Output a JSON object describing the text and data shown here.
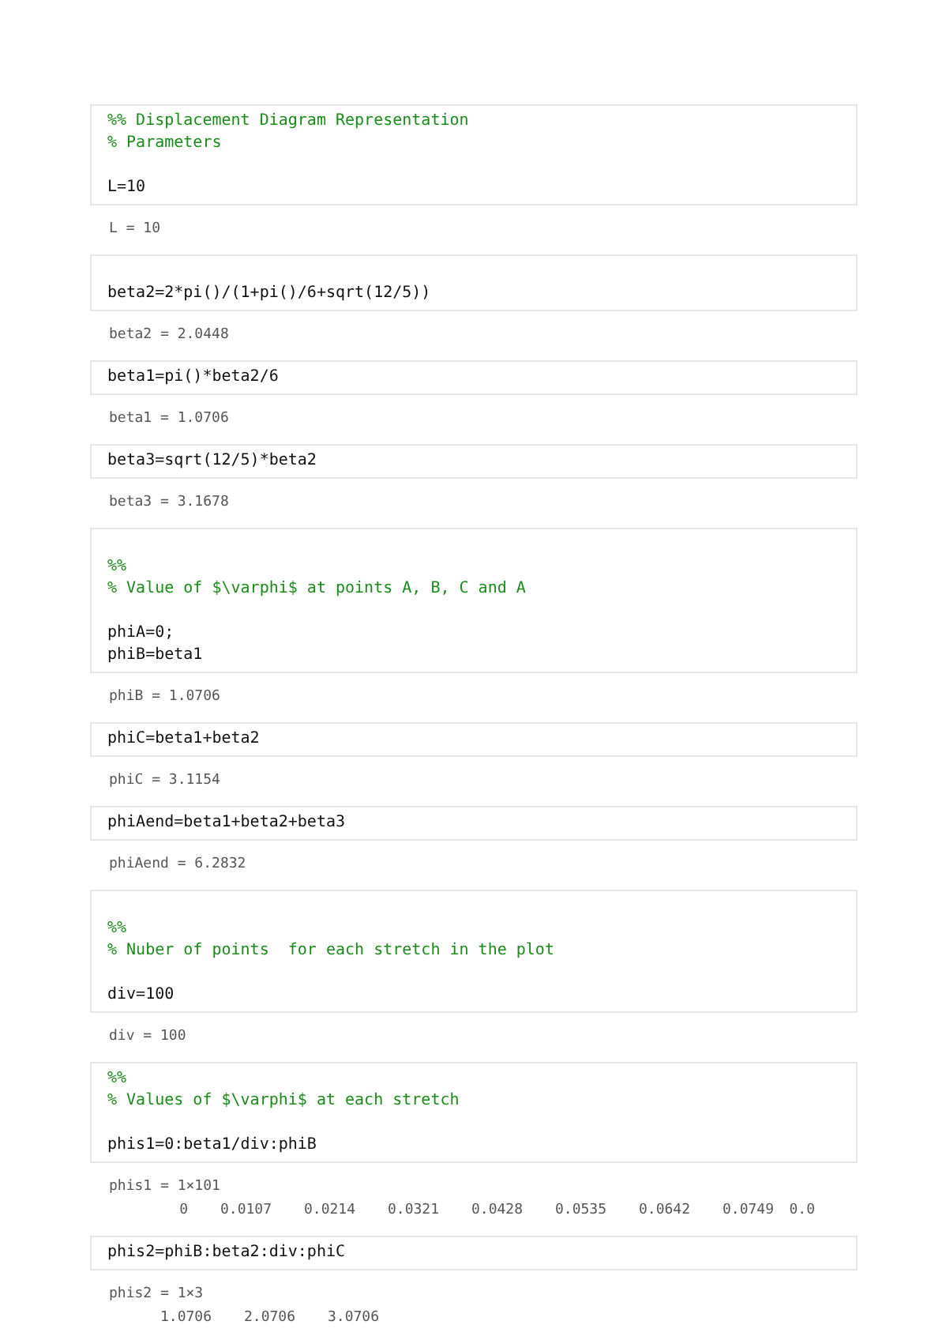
{
  "cells": [
    {
      "kind": "code",
      "lines": [
        {
          "kind": "comment",
          "text": "%% Displacement Diagram Representation"
        },
        {
          "kind": "comment",
          "text": "% Parameters"
        },
        {
          "kind": "blank"
        },
        {
          "kind": "code",
          "text": "L=10"
        }
      ]
    },
    {
      "kind": "output",
      "lines": [
        {
          "kind": "text",
          "text": "L = 10"
        }
      ]
    },
    {
      "kind": "code",
      "lines": [
        {
          "kind": "blank"
        },
        {
          "kind": "code",
          "text": "beta2=2*pi()/(1+pi()/6+sqrt(12/5))"
        }
      ]
    },
    {
      "kind": "output",
      "lines": [
        {
          "kind": "text",
          "text": "beta2 = 2.0448"
        }
      ]
    },
    {
      "kind": "code",
      "lines": [
        {
          "kind": "code",
          "text": "beta1=pi()*beta2/6"
        }
      ]
    },
    {
      "kind": "output",
      "lines": [
        {
          "kind": "text",
          "text": "beta1 = 1.0706"
        }
      ]
    },
    {
      "kind": "code",
      "lines": [
        {
          "kind": "code",
          "text": "beta3=sqrt(12/5)*beta2"
        }
      ]
    },
    {
      "kind": "output",
      "lines": [
        {
          "kind": "text",
          "text": "beta3 = 3.1678"
        }
      ]
    },
    {
      "kind": "code",
      "lines": [
        {
          "kind": "blank"
        },
        {
          "kind": "comment",
          "text": "%%"
        },
        {
          "kind": "comment",
          "text": "% Value of $\\varphi$ at points A, B, C and A"
        },
        {
          "kind": "blank"
        },
        {
          "kind": "code",
          "text": "phiA=0;"
        },
        {
          "kind": "code",
          "text": "phiB=beta1"
        }
      ]
    },
    {
      "kind": "output",
      "lines": [
        {
          "kind": "text",
          "text": "phiB = 1.0706"
        }
      ]
    },
    {
      "kind": "code",
      "lines": [
        {
          "kind": "code",
          "text": "phiC=beta1+beta2"
        }
      ]
    },
    {
      "kind": "output",
      "lines": [
        {
          "kind": "text",
          "text": "phiC = 3.1154"
        }
      ]
    },
    {
      "kind": "code",
      "lines": [
        {
          "kind": "code",
          "text": "phiAend=beta1+beta2+beta3"
        }
      ]
    },
    {
      "kind": "output",
      "lines": [
        {
          "kind": "text",
          "text": "phiAend = 6.2832"
        }
      ]
    },
    {
      "kind": "code",
      "lines": [
        {
          "kind": "blank"
        },
        {
          "kind": "comment",
          "text": "%%"
        },
        {
          "kind": "comment",
          "text": "% Nuber of points  for each stretch in the plot"
        },
        {
          "kind": "blank"
        },
        {
          "kind": "code",
          "text": "div=100"
        }
      ]
    },
    {
      "kind": "output",
      "lines": [
        {
          "kind": "text",
          "text": "div = 100"
        }
      ]
    },
    {
      "kind": "code",
      "lines": [
        {
          "kind": "comment",
          "text": "%%"
        },
        {
          "kind": "comment",
          "text": "% Values of $\\varphi$ at each stretch"
        },
        {
          "kind": "blank"
        },
        {
          "kind": "code",
          "text": "phis1=0:beta1/div:phiB"
        }
      ]
    },
    {
      "kind": "output",
      "lines": [
        {
          "kind": "text",
          "text": "phis1 = 1×101"
        },
        {
          "kind": "row",
          "values": [
            "0",
            "0.0107",
            "0.0214",
            "0.0321",
            "0.0428",
            "0.0535",
            "0.0642",
            "0.0749",
            "0.0"
          ]
        }
      ]
    },
    {
      "kind": "code",
      "lines": [
        {
          "kind": "code",
          "text": "phis2=phiB:beta2:div:phiC"
        }
      ]
    },
    {
      "kind": "output",
      "lines": [
        {
          "kind": "text",
          "text": "phis2 = 1×3"
        },
        {
          "kind": "row",
          "values": [
            "1.0706",
            "2.0706",
            "3.0706"
          ]
        }
      ]
    }
  ]
}
